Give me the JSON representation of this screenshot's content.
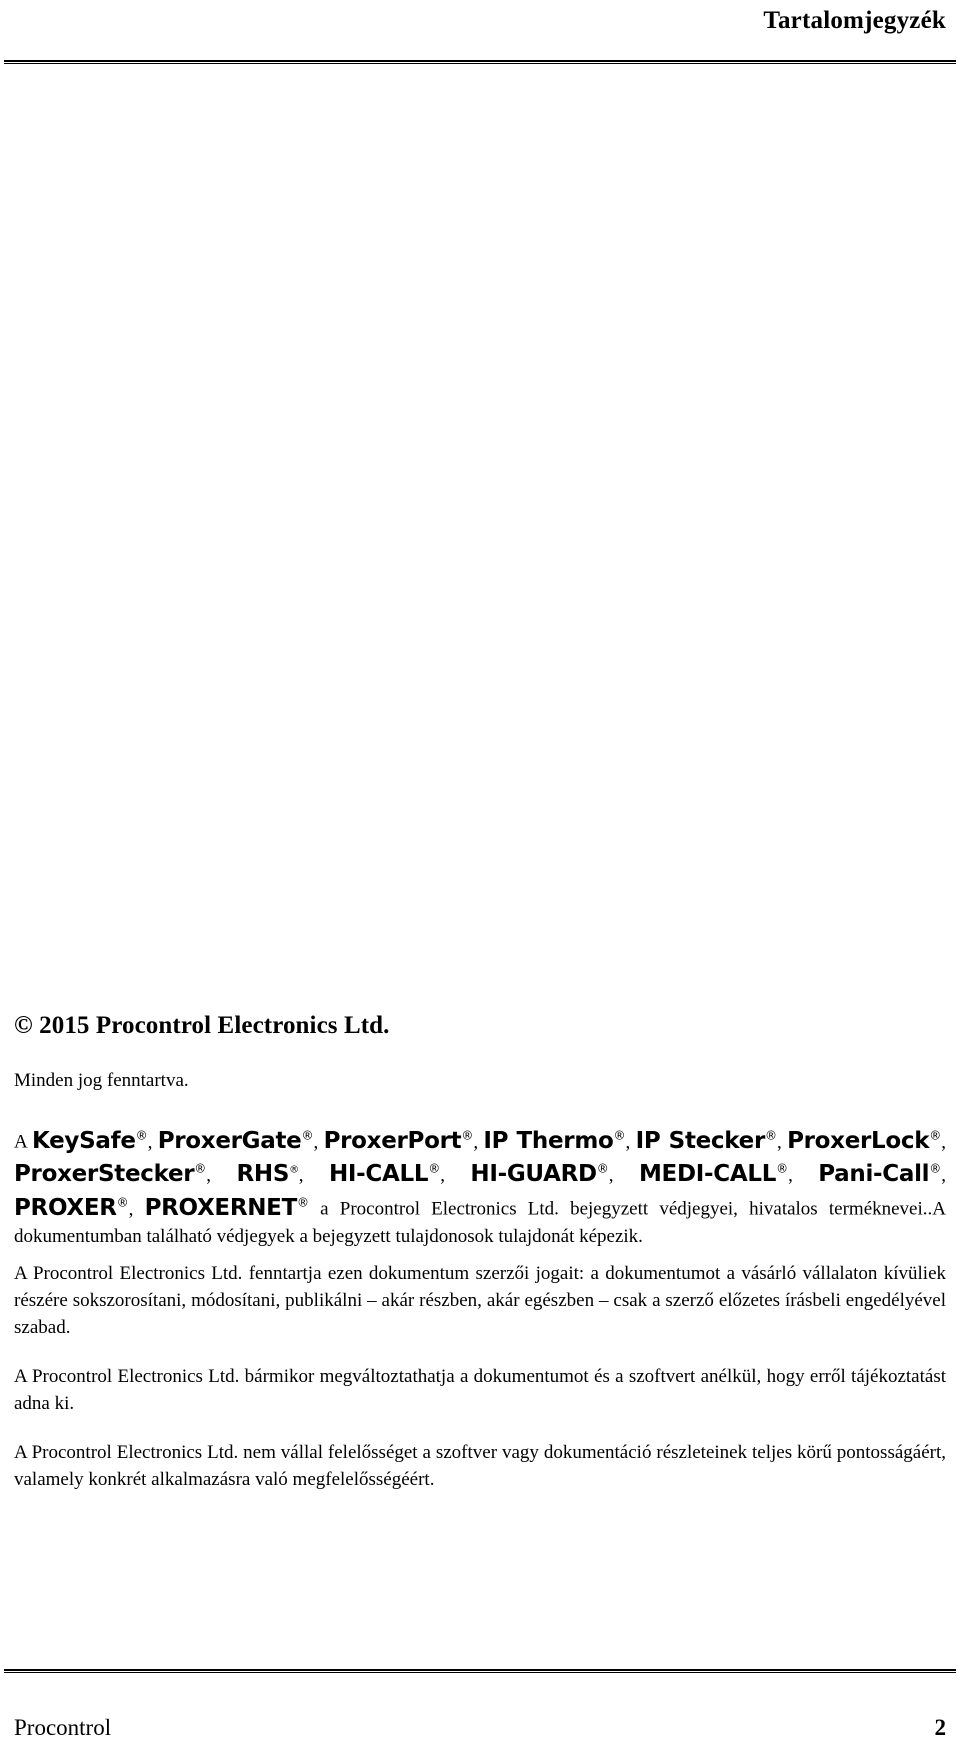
{
  "header": {
    "title": "Tartalomjegyzék"
  },
  "copyright": {
    "symbol": "©",
    "text": "© 2015 Procontrol Electronics Ltd.",
    "rights": "Minden jog fenntartva."
  },
  "trademarks": {
    "lead": "A",
    "reg_mark": "®",
    "brands": [
      "KeySafe",
      "ProxerGate",
      "ProxerPort",
      "IP Thermo",
      "IP Stecker",
      "ProxerLock",
      "ProxerStecker",
      "RHS",
      "HI-CALL",
      "HI-GUARD",
      "MEDI-CALL",
      "Pani-Call",
      "PROXER",
      "PROXERNET"
    ],
    "separator": ", ",
    "tail": " a Procontrol Electronics Ltd. bejegyzett védjegyei, hivatalos terméknevei..A dokumentumban található védjegyek a bejegyzett tulajdonosok tulajdonát képezik."
  },
  "paragraphs": [
    "A Procontrol Electronics Ltd. fenntartja ezen dokumentum szerzői jogait: a dokumentumot a vásárló vállalaton kívüliek részére sokszorosítani, módosítani, publikálni – akár részben, akár egészben – csak a szerző előzetes írásbeli engedélyével szabad.",
    "A Procontrol Electronics Ltd. bármikor megváltoztathatja a dokumentumot és a szoftvert anélkül, hogy erről tájékoztatást adna ki.",
    "A Procontrol Electronics Ltd. nem vállal felelősséget a szoftver vagy dokumentáció részleteinek teljes körű pontosságáért, valamely konkrét alkalmazásra való megfelelősségéért."
  ],
  "footer": {
    "company": "Procontrol",
    "page_number": "2"
  }
}
